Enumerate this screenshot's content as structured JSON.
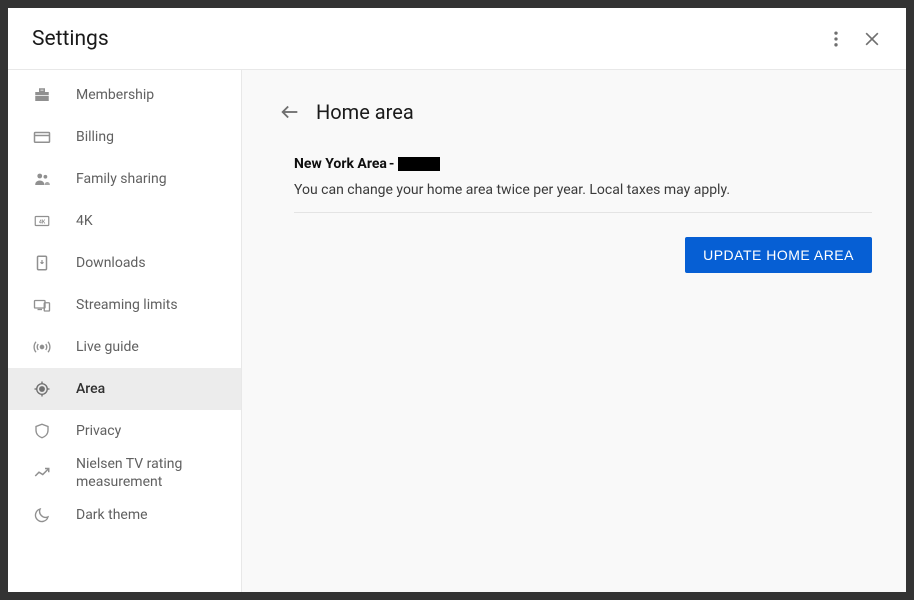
{
  "header": {
    "title": "Settings"
  },
  "sidebar": {
    "items": [
      {
        "label": "Membership"
      },
      {
        "label": "Billing"
      },
      {
        "label": "Family sharing"
      },
      {
        "label": "4K"
      },
      {
        "label": "Downloads"
      },
      {
        "label": "Streaming limits"
      },
      {
        "label": "Live guide"
      },
      {
        "label": "Area"
      },
      {
        "label": "Privacy"
      },
      {
        "label": "Nielsen TV rating measurement"
      },
      {
        "label": "Dark theme"
      }
    ],
    "selected_index": 7
  },
  "main": {
    "title": "Home area",
    "area_label": "New York Area",
    "description": "You can change your home area twice per year. Local taxes may apply.",
    "update_button": "UPDATE HOME AREA"
  }
}
